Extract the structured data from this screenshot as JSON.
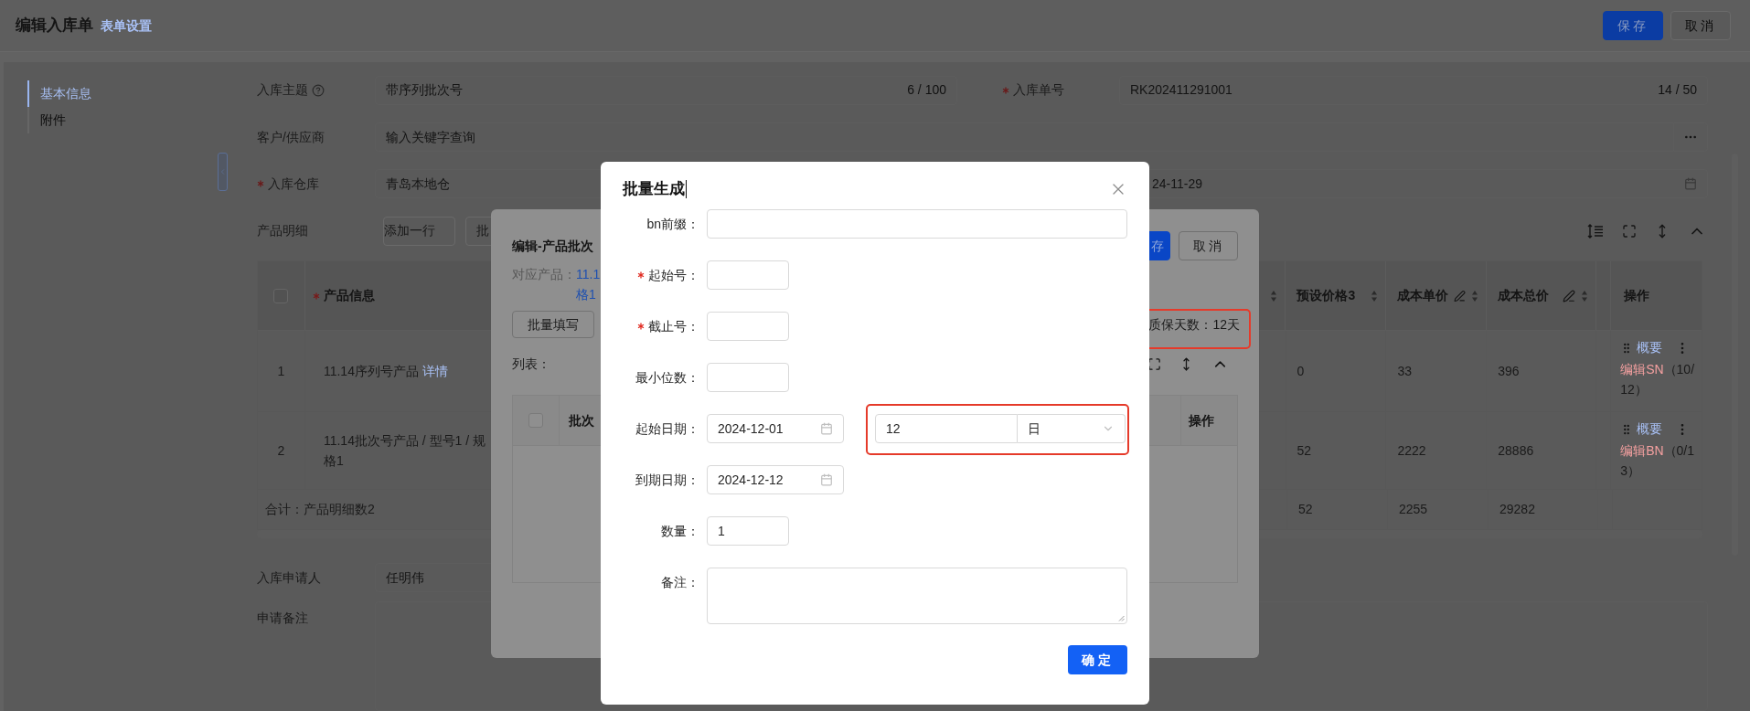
{
  "header": {
    "title": "编辑入库单",
    "link": "表单设置",
    "buttons": [
      {
        "label": "保存",
        "kind": "primary"
      },
      {
        "label": "取消",
        "kind": "default"
      }
    ]
  },
  "sidebar": {
    "items": [
      {
        "label": "基本信息",
        "selected": true
      },
      {
        "label": "附件",
        "selected": false
      }
    ]
  },
  "form": {
    "subject": {
      "label": "入库主题",
      "value": "带序列批次号",
      "count": "6 / 100"
    },
    "order_no": {
      "label": "入库单号",
      "required": true,
      "value": "RK202411291001",
      "count": "14 / 50"
    },
    "supplier": {
      "label": "客户/供应商",
      "placeholder": "输入关键字查询"
    },
    "warehouse": {
      "label": "入库仓库",
      "required": true,
      "value": "青岛本地仓"
    },
    "date": {
      "value": "24-11-29"
    }
  },
  "products": {
    "label": "产品明细",
    "buttons": [
      "添加一行",
      "批"
    ],
    "table": {
      "select_all": {
        "checked": false
      },
      "columns": [
        {
          "label": "产品信息",
          "required": true
        },
        {
          "label": "预设价格3"
        },
        {
          "label": "成本单价",
          "editable": true
        },
        {
          "label": "成本总价",
          "editable": true
        },
        {
          "label": "操作"
        }
      ],
      "rows": [
        {
          "index": "1",
          "product": "11.14序列号产品",
          "detail_link": "详情",
          "values": [
            "0",
            "33",
            "396"
          ],
          "summary_link": "概要",
          "edit_link": "编辑SN",
          "progress": "（10/12）"
        },
        {
          "index": "2",
          "product": "11.14批次号产品 / 型号1 / 规格1",
          "values": [
            "52",
            "2222",
            "28886"
          ],
          "summary_link": "概要",
          "edit_link": "编辑BN",
          "progress": "（0/13）"
        }
      ],
      "total": {
        "label": "合计：产品明细数2",
        "values": [
          "52",
          "2255",
          "29282"
        ]
      }
    }
  },
  "applicant": {
    "label": "入库申请人",
    "value": "任明伟"
  },
  "remark": {
    "label": "申请备注"
  },
  "edit_dialog": {
    "title": "编辑-产品批次",
    "buttons": [
      {
        "label": "存",
        "kind": "primary"
      },
      {
        "label": "取消",
        "kind": "default"
      }
    ],
    "product_label": "对应产品：",
    "product_lines": [
      "11.1",
      "格1"
    ],
    "batch_fill_button": "批量填写",
    "warranty": "质保天数：12天",
    "list_label": "列表：",
    "table": {
      "select_all": {
        "checked": false
      },
      "columns": [
        "批次",
        "操作"
      ]
    }
  },
  "batch_modal": {
    "title": "批量生成",
    "fields": [
      {
        "kind": "wide",
        "label": "bn前缀："
      },
      {
        "kind": "short",
        "label": "起始号：",
        "required": true
      },
      {
        "kind": "short",
        "label": "截止号：",
        "required": true
      },
      {
        "kind": "short",
        "label": "最小位数："
      },
      {
        "kind": "date",
        "label": "起始日期：",
        "value": "2024-12-01",
        "duration": {
          "value": "12",
          "unit": "日"
        }
      },
      {
        "kind": "date",
        "label": "到期日期：",
        "value": "2024-12-12"
      },
      {
        "kind": "short",
        "label": "数量：",
        "value": "1"
      },
      {
        "kind": "textarea",
        "label": "备注："
      }
    ],
    "confirm_button": "确定"
  }
}
